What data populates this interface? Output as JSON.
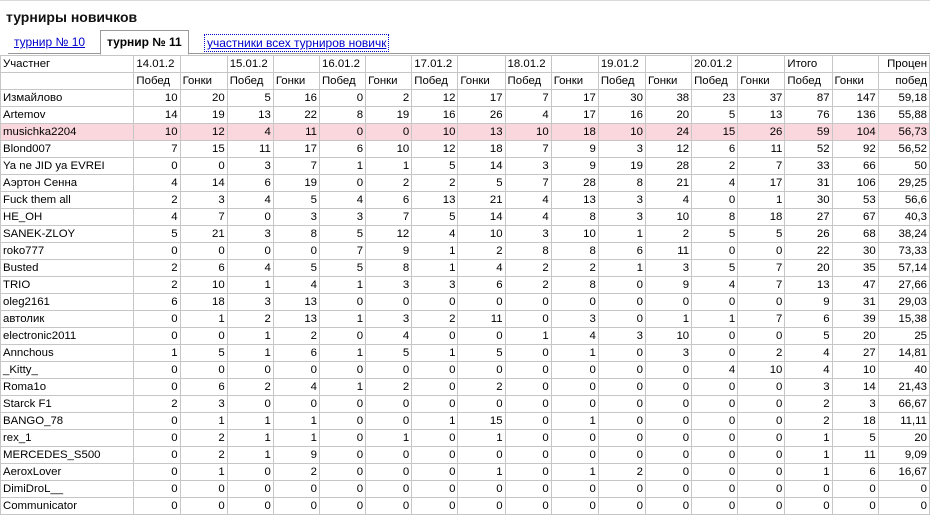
{
  "page": {
    "title": "турниры новичков"
  },
  "tabs": [
    {
      "label": "турнир № 10",
      "state": "link"
    },
    {
      "label": "турнир № 11",
      "state": "active"
    },
    {
      "label": "участники всех турниров новичк",
      "state": "outlined"
    }
  ],
  "header": {
    "participant_label": "Участнег",
    "dates": [
      "14.01.2",
      "15.01.2",
      "16.01.2",
      "17.01.2",
      "18.01.2",
      "19.01.2",
      "20.01.2"
    ],
    "total_label": "Итого",
    "percent_label_top": "Процен",
    "wins_label": "Побед",
    "races_label": "Гонки",
    "percent_label_bottom": "побед"
  },
  "rows": [
    {
      "name": "Измайлово",
      "cells": [
        "10",
        "20",
        "5",
        "16",
        "0",
        "2",
        "12",
        "17",
        "7",
        "17",
        "30",
        "38",
        "23",
        "37",
        "87",
        "147",
        "59,18"
      ]
    },
    {
      "name": "Artemov",
      "cells": [
        "14",
        "19",
        "13",
        "22",
        "8",
        "19",
        "16",
        "26",
        "4",
        "17",
        "16",
        "20",
        "5",
        "13",
        "76",
        "136",
        "55,88"
      ]
    },
    {
      "name": "musichka2204",
      "highlight": true,
      "cells": [
        "10",
        "12",
        "4",
        "11",
        "0",
        "0",
        "10",
        "13",
        "10",
        "18",
        "10",
        "24",
        "15",
        "26",
        "59",
        "104",
        "56,73"
      ]
    },
    {
      "name": "Blond007",
      "cells": [
        "7",
        "15",
        "11",
        "17",
        "6",
        "10",
        "12",
        "18",
        "7",
        "9",
        "3",
        "12",
        "6",
        "11",
        "52",
        "92",
        "56,52"
      ]
    },
    {
      "name": "Ya ne JID ya EVREI",
      "cells": [
        "0",
        "0",
        "3",
        "7",
        "1",
        "1",
        "5",
        "14",
        "3",
        "9",
        "19",
        "28",
        "2",
        "7",
        "33",
        "66",
        "50"
      ]
    },
    {
      "name": "Аэртон Сенна",
      "cells": [
        "4",
        "14",
        "6",
        "19",
        "0",
        "2",
        "2",
        "5",
        "7",
        "28",
        "8",
        "21",
        "4",
        "17",
        "31",
        "106",
        "29,25"
      ]
    },
    {
      "name": "Fuck them all",
      "cells": [
        "2",
        "3",
        "4",
        "5",
        "4",
        "6",
        "13",
        "21",
        "4",
        "13",
        "3",
        "4",
        "0",
        "1",
        "30",
        "53",
        "56,6"
      ]
    },
    {
      "name": "HE_OH",
      "cells": [
        "4",
        "7",
        "0",
        "3",
        "3",
        "7",
        "5",
        "14",
        "4",
        "8",
        "3",
        "10",
        "8",
        "18",
        "27",
        "67",
        "40,3"
      ]
    },
    {
      "name": "SANEK-ZLOY",
      "cells": [
        "5",
        "21",
        "3",
        "8",
        "5",
        "12",
        "4",
        "10",
        "3",
        "10",
        "1",
        "2",
        "5",
        "5",
        "26",
        "68",
        "38,24"
      ]
    },
    {
      "name": "roko777",
      "cells": [
        "0",
        "0",
        "0",
        "0",
        "7",
        "9",
        "1",
        "2",
        "8",
        "8",
        "6",
        "11",
        "0",
        "0",
        "22",
        "30",
        "73,33"
      ]
    },
    {
      "name": "Busted",
      "cells": [
        "2",
        "6",
        "4",
        "5",
        "5",
        "8",
        "1",
        "4",
        "2",
        "2",
        "1",
        "3",
        "5",
        "7",
        "20",
        "35",
        "57,14"
      ]
    },
    {
      "name": "TRIO",
      "cells": [
        "2",
        "10",
        "1",
        "4",
        "1",
        "3",
        "3",
        "6",
        "2",
        "8",
        "0",
        "9",
        "4",
        "7",
        "13",
        "47",
        "27,66"
      ]
    },
    {
      "name": "oleg2161",
      "cells": [
        "6",
        "18",
        "3",
        "13",
        "0",
        "0",
        "0",
        "0",
        "0",
        "0",
        "0",
        "0",
        "0",
        "0",
        "9",
        "31",
        "29,03"
      ]
    },
    {
      "name": "автолик",
      "cells": [
        "0",
        "1",
        "2",
        "13",
        "1",
        "3",
        "2",
        "11",
        "0",
        "3",
        "0",
        "1",
        "1",
        "7",
        "6",
        "39",
        "15,38"
      ]
    },
    {
      "name": "electronic2011",
      "cells": [
        "0",
        "0",
        "1",
        "2",
        "0",
        "4",
        "0",
        "0",
        "1",
        "4",
        "3",
        "10",
        "0",
        "0",
        "5",
        "20",
        "25"
      ]
    },
    {
      "name": "Annchous",
      "cells": [
        "1",
        "5",
        "1",
        "6",
        "1",
        "5",
        "1",
        "5",
        "0",
        "1",
        "0",
        "3",
        "0",
        "2",
        "4",
        "27",
        "14,81"
      ]
    },
    {
      "name": "_Kitty_",
      "cells": [
        "0",
        "0",
        "0",
        "0",
        "0",
        "0",
        "0",
        "0",
        "0",
        "0",
        "0",
        "0",
        "4",
        "10",
        "4",
        "10",
        "40"
      ]
    },
    {
      "name": "Roma1o",
      "cells": [
        "0",
        "6",
        "2",
        "4",
        "1",
        "2",
        "0",
        "2",
        "0",
        "0",
        "0",
        "0",
        "0",
        "0",
        "3",
        "14",
        "21,43"
      ]
    },
    {
      "name": "Starck F1",
      "cells": [
        "2",
        "3",
        "0",
        "0",
        "0",
        "0",
        "0",
        "0",
        "0",
        "0",
        "0",
        "0",
        "0",
        "0",
        "2",
        "3",
        "66,67"
      ]
    },
    {
      "name": "BANGO_78",
      "cells": [
        "0",
        "1",
        "1",
        "1",
        "0",
        "0",
        "1",
        "15",
        "0",
        "1",
        "0",
        "0",
        "0",
        "0",
        "2",
        "18",
        "11,11"
      ]
    },
    {
      "name": "rex_1",
      "cells": [
        "0",
        "2",
        "1",
        "1",
        "0",
        "1",
        "0",
        "1",
        "0",
        "0",
        "0",
        "0",
        "0",
        "0",
        "1",
        "5",
        "20"
      ]
    },
    {
      "name": "MERCEDES_S500",
      "cells": [
        "0",
        "2",
        "1",
        "9",
        "0",
        "0",
        "0",
        "0",
        "0",
        "0",
        "0",
        "0",
        "0",
        "0",
        "1",
        "11",
        "9,09"
      ]
    },
    {
      "name": "AeroxLover",
      "cells": [
        "0",
        "1",
        "0",
        "2",
        "0",
        "0",
        "0",
        "1",
        "0",
        "1",
        "2",
        "0",
        "0",
        "0",
        "1",
        "6",
        "16,67"
      ]
    },
    {
      "name": "DimiDroL__",
      "cells": [
        "0",
        "0",
        "0",
        "0",
        "0",
        "0",
        "0",
        "0",
        "0",
        "0",
        "0",
        "0",
        "0",
        "0",
        "0",
        "0",
        "0"
      ]
    },
    {
      "name": "Communicator",
      "cells": [
        "0",
        "0",
        "0",
        "0",
        "0",
        "0",
        "0",
        "0",
        "0",
        "0",
        "0",
        "0",
        "0",
        "0",
        "0",
        "0",
        "0"
      ]
    }
  ]
}
